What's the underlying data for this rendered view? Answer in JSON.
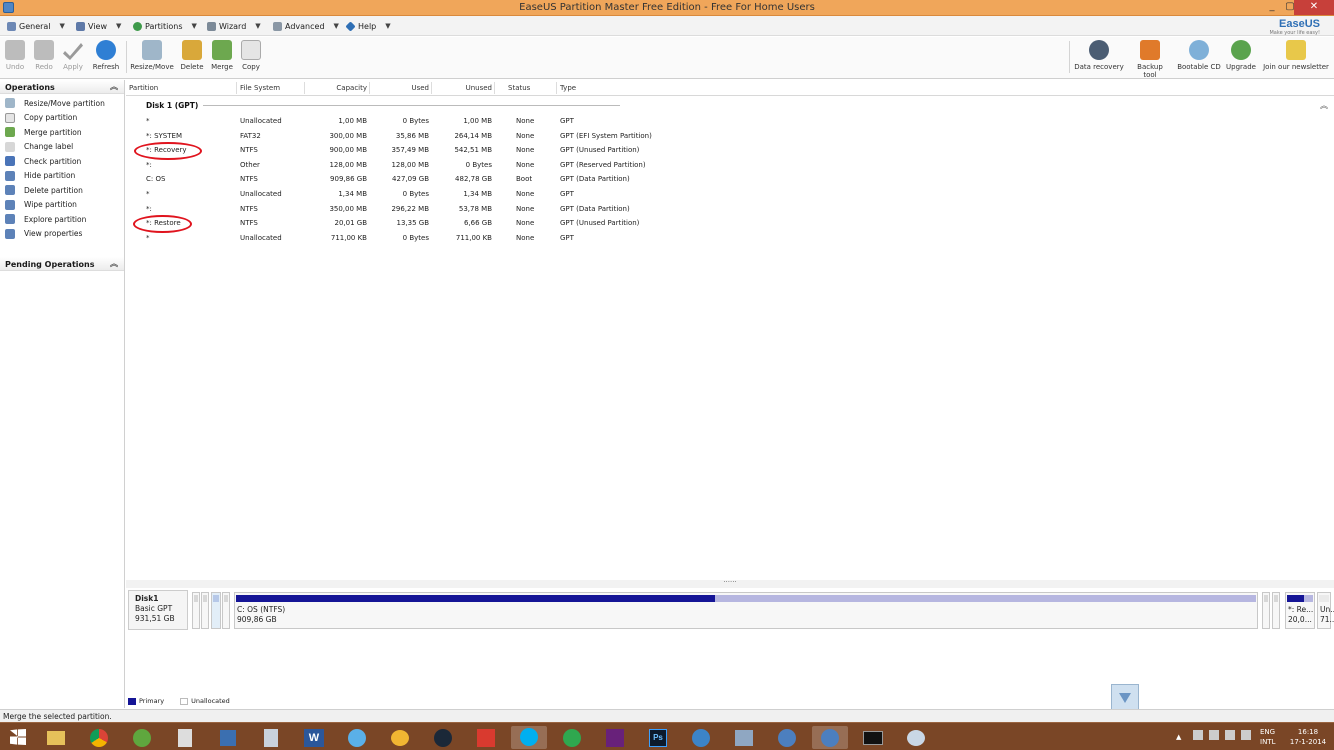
{
  "window": {
    "title": "EaseUS Partition Master Free Edition - Free For Home Users",
    "minimize": "_",
    "maximize": "▢",
    "close": "✕"
  },
  "menubar": {
    "items": [
      "General",
      "View",
      "Partitions",
      "Wizard",
      "Advanced",
      "Help"
    ]
  },
  "brand": {
    "name": "EaseUS",
    "tagline": "Make your life easy!"
  },
  "toolbar": {
    "undo": "Undo",
    "redo": "Redo",
    "apply": "Apply",
    "refresh": "Refresh",
    "resize": "Resize/Move",
    "delete": "Delete",
    "merge": "Merge",
    "copy": "Copy",
    "data_recovery": "Data recovery",
    "backup_tool": "Backup tool",
    "bootable_cd": "Bootable CD",
    "upgrade": "Upgrade",
    "newsletter": "Join our newsletter"
  },
  "sidebar": {
    "operations_title": "Operations",
    "operations": [
      "Resize/Move partition",
      "Copy partition",
      "Merge partition",
      "Change label",
      "Check partition",
      "Hide partition",
      "Delete partition",
      "Wipe partition",
      "Explore partition",
      "View properties"
    ],
    "pending_title": "Pending Operations"
  },
  "table": {
    "headers": [
      "Partition",
      "File System",
      "Capacity",
      "Used",
      "Unused",
      "Status",
      "Type"
    ],
    "disk_label": "Disk 1 (GPT)",
    "rows": [
      [
        "*",
        "Unallocated",
        "1,00 MB",
        "0 Bytes",
        "1,00 MB",
        "None",
        "GPT"
      ],
      [
        "*: SYSTEM",
        "FAT32",
        "300,00 MB",
        "35,86 MB",
        "264,14 MB",
        "None",
        "GPT (EFI System Partition)"
      ],
      [
        "*: Recovery",
        "NTFS",
        "900,00 MB",
        "357,49 MB",
        "542,51 MB",
        "None",
        "GPT (Unused Partition)"
      ],
      [
        "*:",
        "Other",
        "128,00 MB",
        "128,00 MB",
        "0 Bytes",
        "None",
        "GPT (Reserved Partition)"
      ],
      [
        "C: OS",
        "NTFS",
        "909,86 GB",
        "427,09 GB",
        "482,78 GB",
        "Boot",
        "GPT (Data Partition)"
      ],
      [
        "*",
        "Unallocated",
        "1,34 MB",
        "0 Bytes",
        "1,34 MB",
        "None",
        "GPT"
      ],
      [
        "*:",
        "NTFS",
        "350,00 MB",
        "296,22 MB",
        "53,78 MB",
        "None",
        "GPT (Data Partition)"
      ],
      [
        "*: Restore",
        "NTFS",
        "20,01 GB",
        "13,35 GB",
        "6,66 GB",
        "None",
        "GPT (Unused Partition)"
      ],
      [
        "*",
        "Unallocated",
        "711,00 KB",
        "0 Bytes",
        "711,00 KB",
        "None",
        "GPT"
      ]
    ]
  },
  "diskmap": {
    "disk_name": "Disk1",
    "disk_type": "Basic GPT",
    "disk_size": "931,51 GB",
    "main_label": "C: OS (NTFS)",
    "main_size": "909,86 GB",
    "main_used_fraction": 0.47,
    "right_label1": "*: Re...",
    "right_size1": "20,0...",
    "right_label2": "Un...",
    "right_size2": "71..."
  },
  "legend": {
    "primary": "Primary",
    "unallocated": "Unallocated",
    "primary_color": "#151596"
  },
  "statusbar": {
    "text": "Merge the selected partition."
  },
  "taskbar": {
    "lang1": "ENG",
    "lang2": "INTL",
    "time": "16:18",
    "date": "17-1-2014",
    "word_letter": "W",
    "ps_letters": "Ps",
    "tray_arrow": "▲"
  }
}
